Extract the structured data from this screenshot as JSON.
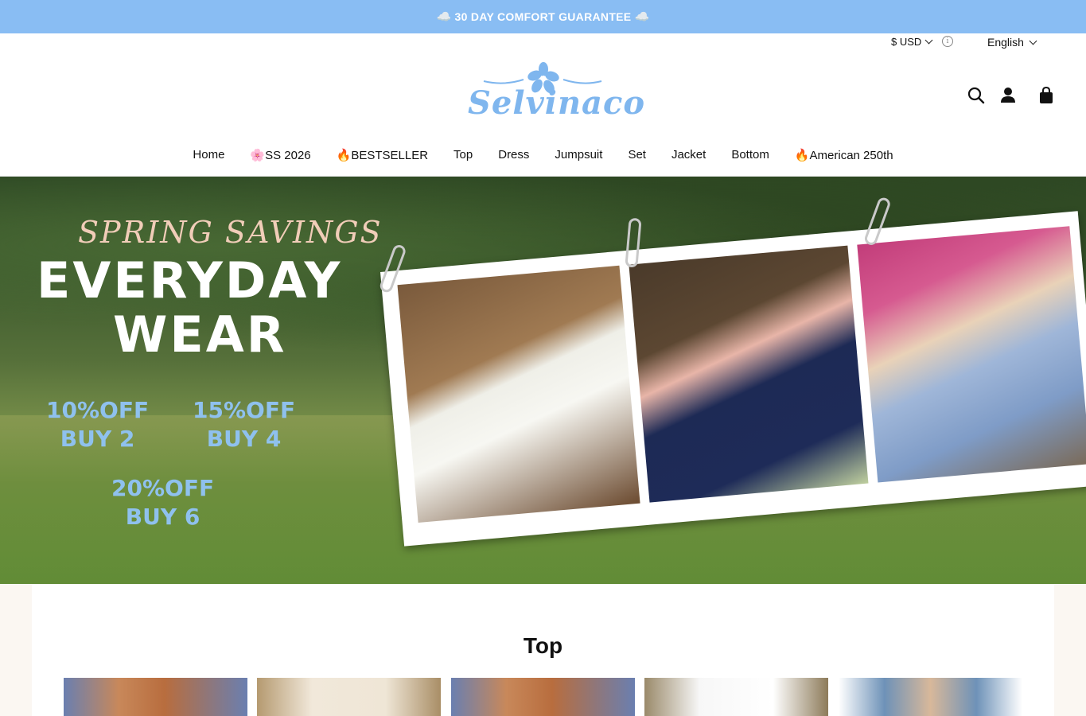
{
  "announcement": {
    "cloud_left": "☁️",
    "text": "30 DAY COMFORT GUARANTEE",
    "cloud_right": "☁️"
  },
  "utility": {
    "currency": "$ USD",
    "language": "English"
  },
  "logo": {
    "text": "Selvinaco"
  },
  "header_icons": [
    "search-icon",
    "account-icon",
    "cart-icon"
  ],
  "nav": {
    "items": [
      {
        "label": "Home"
      },
      {
        "label": "🌸SS 2026"
      },
      {
        "label": "🔥BESTSELLER"
      },
      {
        "label": "Top"
      },
      {
        "label": "Dress"
      },
      {
        "label": "Jumpsuit"
      },
      {
        "label": "Set"
      },
      {
        "label": "Jacket"
      },
      {
        "label": "Bottom"
      },
      {
        "label": "🔥American 250th"
      }
    ]
  },
  "hero": {
    "kicker": "SPRING SAVINGS",
    "headline_1": "EVERYDAY",
    "headline_2": "WEAR",
    "offers": [
      {
        "discount": "10%OFF",
        "condition": "BUY 2"
      },
      {
        "discount": "15%OFF",
        "condition": "BUY 4"
      },
      {
        "discount": "20%OFF",
        "condition": "BUY 6"
      }
    ]
  },
  "section": {
    "title": "Top"
  },
  "colors": {
    "announcement_bg": "#89bdf3",
    "brand_blue": "#7fb6ee",
    "offer_blue": "#8fc1ee"
  }
}
